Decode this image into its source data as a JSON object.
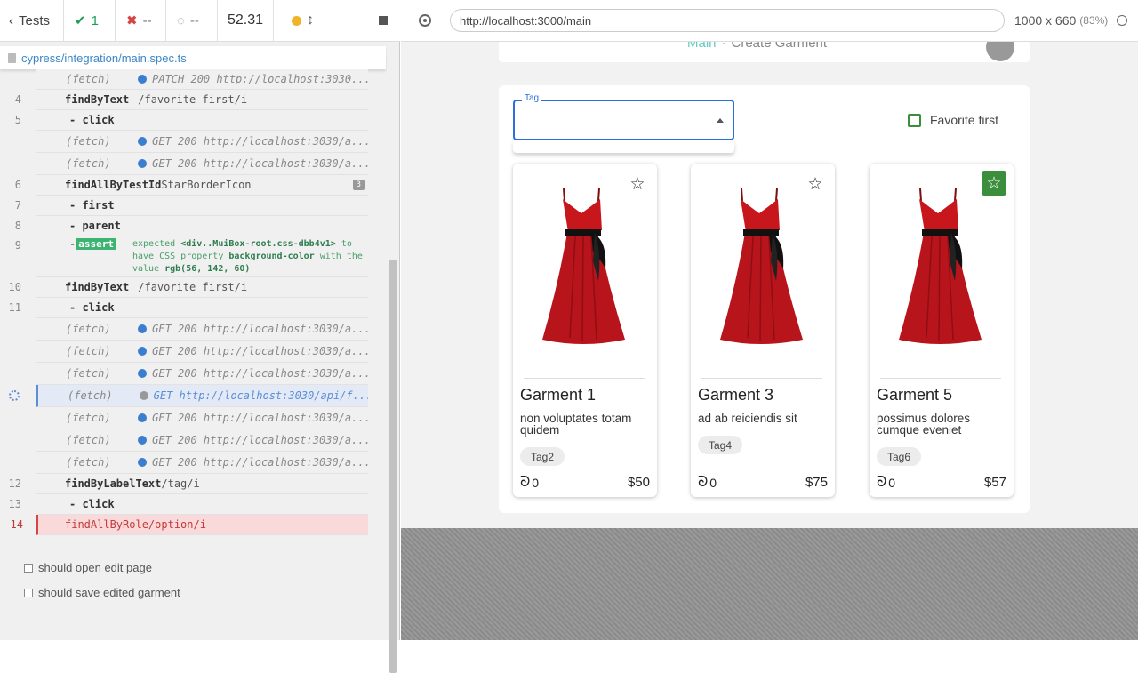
{
  "reporter": {
    "back_label": "Tests",
    "passed": "1",
    "failed": "--",
    "pending": "--",
    "duration": "52.31",
    "spec_path": "cypress/integration/main.spec.ts"
  },
  "commands": {
    "c0_name": "(fetch)",
    "c0_msg": "PATCH 200 http://localhost:3030...",
    "c1_num": "4",
    "c1_name": "findByText",
    "c1_msg": "/favorite first/i",
    "c2_num": "5",
    "c2_name": "- click",
    "c3_name": "(fetch)",
    "c3_msg": "GET 200 http://localhost:3030/a...",
    "c4_name": "(fetch)",
    "c4_msg": "GET 200 http://localhost:3030/a...",
    "c5_num": "6",
    "c5_name": "findAllByTestId",
    "c5_msg": "StarBorderIcon",
    "c5_badge": "3",
    "c6_num": "7",
    "c6_name": "- first",
    "c7_num": "8",
    "c7_name": "- parent",
    "c8_num": "9",
    "c8_tag": "assert",
    "c8_expected": "expected",
    "c8_subject": "<div..MuiBox-root.css-dbb4v1>",
    "c8_to": "to have CSS property",
    "c8_prop": "background-color",
    "c8_with": "with the value",
    "c8_value": "rgb(56, 142, 60)",
    "c9_num": "10",
    "c9_name": "findByText",
    "c9_msg": "/favorite first/i",
    "c10_num": "11",
    "c10_name": "- click",
    "c11_name": "(fetch)",
    "c11_msg": "GET 200 http://localhost:3030/a...",
    "c12_name": "(fetch)",
    "c12_msg": "GET 200 http://localhost:3030/a...",
    "c13_name": "(fetch)",
    "c13_msg": "GET 200 http://localhost:3030/a...",
    "c14_name": "(fetch)",
    "c14_msg": "GET http://localhost:3030/api/f...",
    "c15_name": "(fetch)",
    "c15_msg": "GET 200 http://localhost:3030/a...",
    "c16_name": "(fetch)",
    "c16_msg": "GET 200 http://localhost:3030/a...",
    "c17_name": "(fetch)",
    "c17_msg": "GET 200 http://localhost:3030/a...",
    "c18_num": "12",
    "c18_name": "findByLabelText",
    "c18_msg": "/tag/i",
    "c19_num": "13",
    "c19_name": "- click",
    "c20_num": "14",
    "c20_name": "findAllByRole",
    "c20_msg": "/option/i"
  },
  "tests": [
    "should open edit page",
    "should save edited garment"
  ],
  "browser": {
    "url": "http://localhost:3000/main",
    "viewport": "1000 x 660",
    "scale": "(83%)"
  },
  "app": {
    "breadcrumb_link": "Main",
    "breadcrumb_sep": "·",
    "breadcrumb_current": "Create Garment",
    "tag_label": "Tag",
    "favorite_first_label": "Favorite first",
    "cards": [
      {
        "title": "Garment 1",
        "desc": "non voluptates totam quidem",
        "tag": "Tag2",
        "likes": "0",
        "price": "$50",
        "favorite": false
      },
      {
        "title": "Garment 3",
        "desc": "ad ab reiciendis sit",
        "tag": "Tag4",
        "likes": "0",
        "price": "$75",
        "favorite": false
      },
      {
        "title": "Garment 5",
        "desc": "possimus dolores cumque eveniet",
        "tag": "Tag6",
        "likes": "0",
        "price": "$57",
        "favorite": true
      }
    ]
  },
  "colors": {
    "favorite_on": "#3a8e3c",
    "dress_red": "#c8161d",
    "focus_blue": "#2a6fdb"
  }
}
